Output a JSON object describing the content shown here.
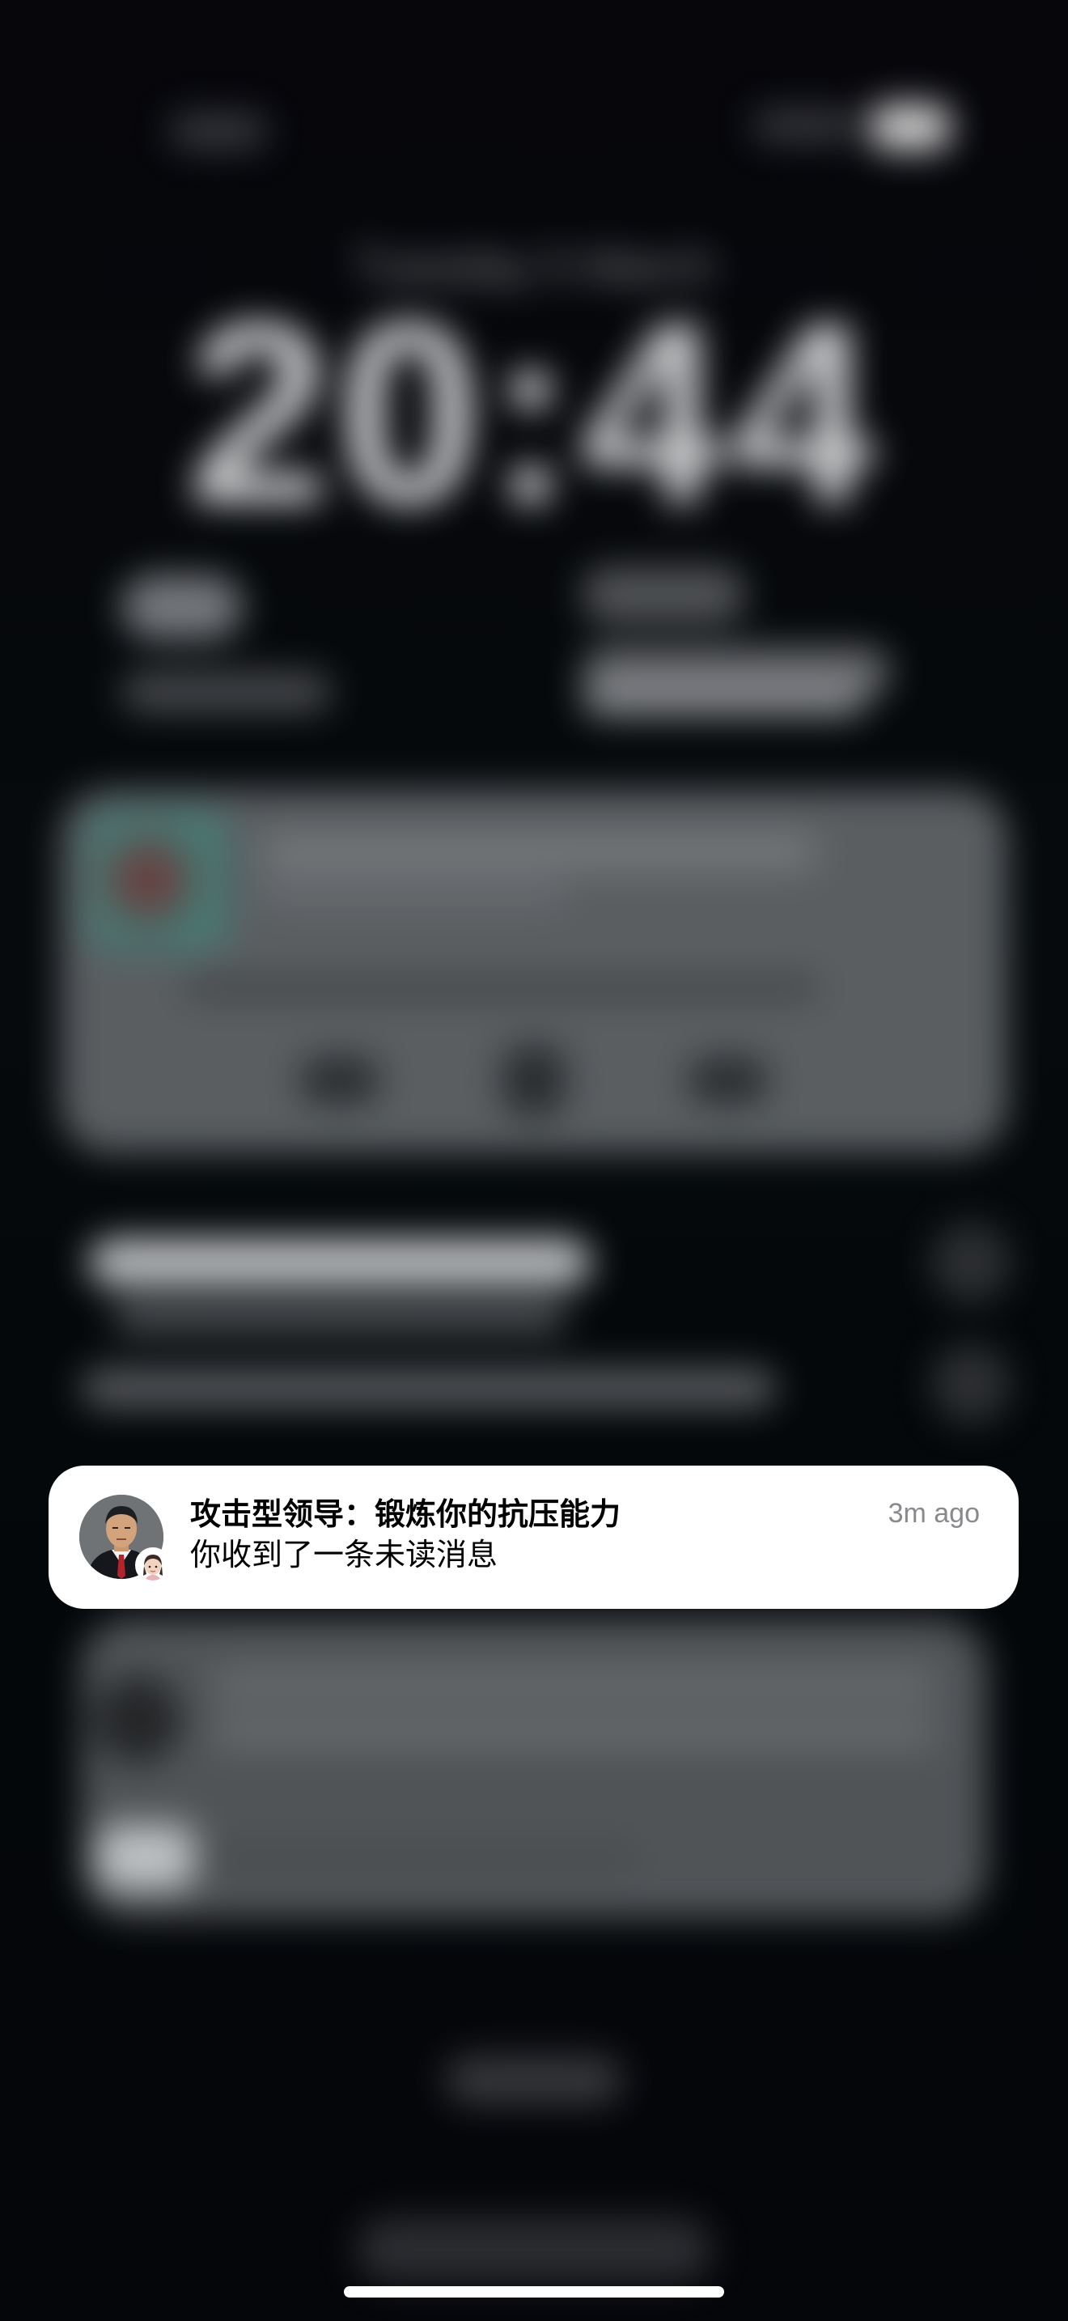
{
  "lock_screen": {
    "date": "Tuesday 5 March",
    "time": "20:44"
  },
  "notification": {
    "title": "攻击型领导：锻炼你的抗压能力",
    "body": "你收到了一条未读消息",
    "timestamp": "3m ago",
    "app_icon": "avatar-icon"
  },
  "colors": {
    "card_background": "#ffffff",
    "title_text": "#000000",
    "timestamp_text": "#8a8a8e",
    "home_indicator": "#ffffff"
  }
}
